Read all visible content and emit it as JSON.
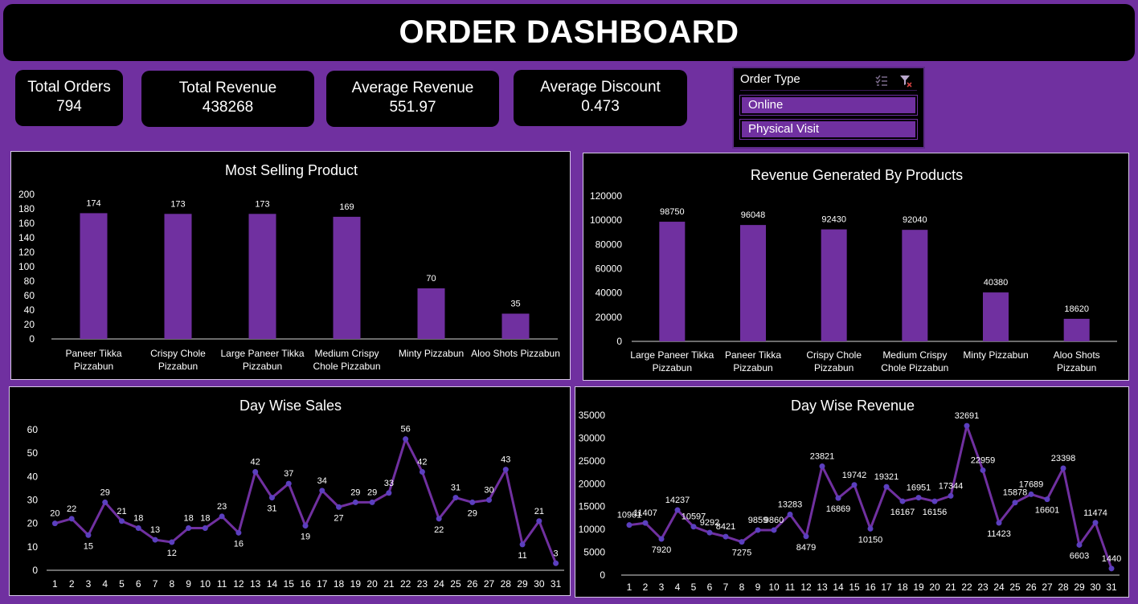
{
  "dashboard": {
    "title": "ORDER DASHBOARD"
  },
  "kpis": {
    "total_orders": {
      "label": "Total Orders",
      "value": "794"
    },
    "total_revenue": {
      "label": "Total Revenue",
      "value": "438268"
    },
    "average_revenue": {
      "label": "Average Revenue",
      "value": "551.97"
    },
    "average_discount": {
      "label": "Average Discount",
      "value": "0.473"
    }
  },
  "slicer": {
    "title": "Order Type",
    "items": [
      "Online",
      "Physical Visit"
    ],
    "icons": [
      "multi-select-icon",
      "clear-filter-icon"
    ]
  },
  "colors": {
    "background": "#7030a0",
    "bar": "#7030a0",
    "line": "#7030a0",
    "marker": "#5b3fbf",
    "panel": "#000000"
  },
  "chart_data": [
    {
      "type": "bar",
      "title": "Most Selling Product",
      "categories": [
        [
          "Paneer Tikka",
          "Pizzabun"
        ],
        [
          "Crispy Chole",
          "Pizzabun"
        ],
        [
          "Large Paneer Tikka",
          "Pizzabun"
        ],
        [
          "Medium Crispy",
          "Chole Pizzabun"
        ],
        [
          "Minty Pizzabun"
        ],
        [
          "Aloo Shots Pizzabun"
        ]
      ],
      "values": [
        174,
        173,
        173,
        169,
        70,
        35
      ],
      "ylim": [
        0,
        200
      ],
      "yticks": [
        0,
        20,
        40,
        60,
        80,
        100,
        120,
        140,
        160,
        180,
        200
      ],
      "data_labels": true
    },
    {
      "type": "bar",
      "title": "Revenue Generated By Products",
      "categories": [
        [
          "Large Paneer Tikka",
          "Pizzabun"
        ],
        [
          "Paneer Tikka",
          "Pizzabun"
        ],
        [
          "Crispy Chole",
          "Pizzabun"
        ],
        [
          "Medium Crispy",
          "Chole Pizzabun"
        ],
        [
          "Minty Pizzabun"
        ],
        [
          "Aloo Shots",
          "Pizzabun"
        ]
      ],
      "values": [
        98750,
        96048,
        92430,
        92040,
        40380,
        18620
      ],
      "ylim": [
        0,
        120000
      ],
      "yticks": [
        0,
        20000,
        40000,
        60000,
        80000,
        100000,
        120000
      ],
      "data_labels": true
    },
    {
      "type": "line",
      "title": "Day Wise Sales",
      "x": [
        1,
        2,
        3,
        4,
        5,
        6,
        7,
        8,
        9,
        10,
        11,
        12,
        13,
        14,
        15,
        16,
        17,
        18,
        19,
        20,
        21,
        22,
        23,
        24,
        25,
        26,
        27,
        28,
        29,
        30,
        31
      ],
      "values": [
        20,
        22,
        15,
        29,
        21,
        18,
        13,
        12,
        18,
        18,
        23,
        16,
        42,
        31,
        37,
        19,
        34,
        27,
        29,
        29,
        33,
        56,
        42,
        22,
        31,
        29,
        30,
        43,
        11,
        21,
        3
      ],
      "ylim": [
        0,
        60
      ],
      "yticks": [
        0,
        10,
        20,
        30,
        40,
        50,
        60
      ],
      "data_labels": true
    },
    {
      "type": "line",
      "title": "Day Wise Revenue",
      "x": [
        1,
        2,
        3,
        4,
        5,
        6,
        7,
        8,
        9,
        10,
        11,
        12,
        13,
        14,
        15,
        16,
        17,
        18,
        19,
        20,
        21,
        22,
        23,
        24,
        25,
        26,
        27,
        28,
        29,
        30,
        31
      ],
      "values": [
        10961,
        11407,
        7920,
        14237,
        10597,
        9292,
        8421,
        7275,
        9859,
        9860,
        13283,
        8479,
        23821,
        16869,
        19742,
        10150,
        19321,
        16167,
        16951,
        16156,
        17344,
        32691,
        22959,
        11423,
        15878,
        17689,
        16601,
        23398,
        6603,
        11474,
        1440
      ],
      "ylim": [
        0,
        35000
      ],
      "yticks": [
        0,
        5000,
        10000,
        15000,
        20000,
        25000,
        30000,
        35000
      ],
      "data_labels": true
    }
  ]
}
